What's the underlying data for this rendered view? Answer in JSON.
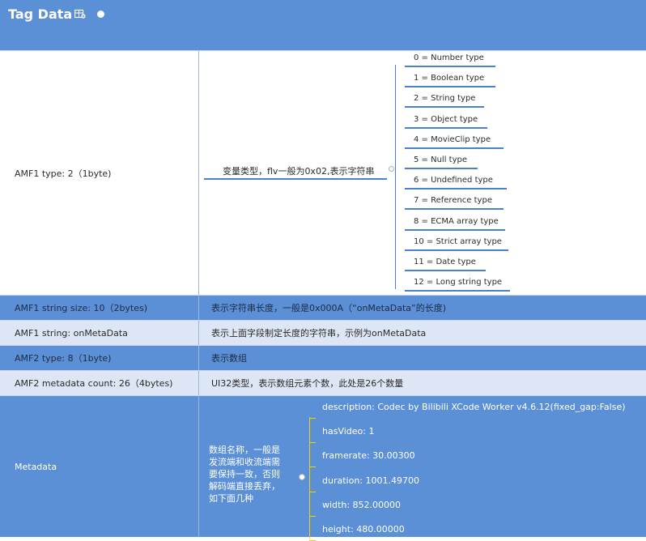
{
  "header": {
    "title": "Tag Data"
  },
  "rows": [
    {
      "label": "AMF1 type: 2（1byte)",
      "desc": "变量类型，flv一般为0x02,表示字符串"
    },
    {
      "label": "AMF1 string size: 10（2bytes)",
      "desc": "表示字符串长度，一般是0x000A（“onMetaData”的长度)"
    },
    {
      "label": "AMF1 string: onMetaData",
      "desc": "表示上面字段制定长度的字符串，示例为onMetaData"
    },
    {
      "label": "AMF2 type: 8（1byte)",
      "desc": "表示数组"
    },
    {
      "label": "AMF2 metadata count: 26（4bytes)",
      "desc": "UI32类型，表示数组元素个数，此处是26个数量"
    },
    {
      "label": "Metadata",
      "desc": "数组名称，一般是\n发流端和收流端需\n要保持一致，否则\n解码端直接丢弃，\n如下面几种"
    }
  ],
  "amf_types": [
    "0 = Number type",
    "1 = Boolean type",
    "2 = String type",
    "3 = Object type",
    "4 = MovieClip type",
    "5 = Null type",
    "6 = Undefined type",
    "7 = Reference type",
    "8 = ECMA array type",
    "10 = Strict array type",
    "11 = Date type",
    "12 = Long string type"
  ],
  "metadata_items": [
    "description: Codec by Bilibili XCode Worker v4.6.12(fixed_gap:False)",
    "hasVideo: 1",
    "framerate: 30.00300",
    "duration: 1001.49700",
    "width: 852.00000",
    "height: 480.00000"
  ],
  "colors": {
    "accent": "#5b8fd6",
    "light_row": "#dde6f4",
    "connector": "#4a80cf",
    "bracket_yellow": "#f0d000"
  }
}
